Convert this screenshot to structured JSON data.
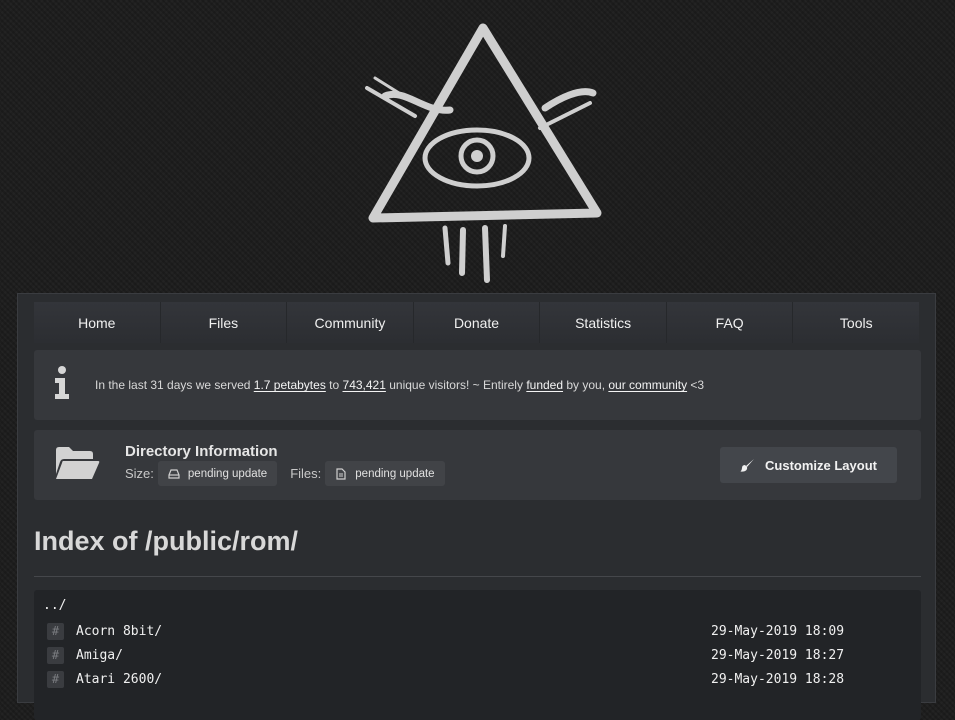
{
  "nav": {
    "items": [
      "Home",
      "Files",
      "Community",
      "Donate",
      "Statistics",
      "FAQ",
      "Tools"
    ]
  },
  "info": {
    "part1": "In the last 31 days we served ",
    "link1": "1.7 petabytes",
    "part2": " to ",
    "link2": "743,421",
    "part3": " unique visitors! ~ Entirely ",
    "link3": "funded",
    "part4": " by you, ",
    "link4": "our community",
    "part5": " <3"
  },
  "directory": {
    "title": "Directory Information",
    "size_label": "Size:",
    "size_value": "pending update",
    "files_label": "Files:",
    "files_value": "pending update",
    "customize_label": "Customize Layout"
  },
  "page": {
    "heading": "Index of /public/rom/"
  },
  "listing": {
    "parent": "../",
    "entries": [
      {
        "name": "Acorn 8bit/",
        "date": "29-May-2019 18:09"
      },
      {
        "name": "Amiga/",
        "date": "29-May-2019 18:27"
      },
      {
        "name": "Atari 2600/",
        "date": "29-May-2019 18:28"
      }
    ]
  },
  "icons": {
    "logo": "eye-pyramid-logo-icon",
    "info": "info-icon",
    "folder": "folder-open-icon",
    "size": "hard-drive-icon",
    "files": "file-icon",
    "customize": "paintbrush-icon",
    "entry": "hash-icon"
  }
}
